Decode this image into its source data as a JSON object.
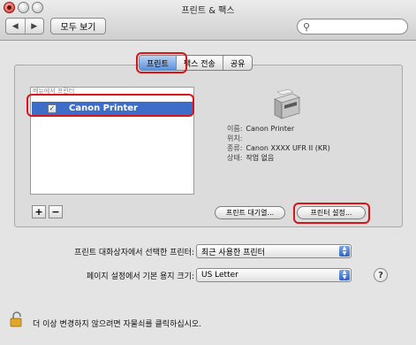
{
  "window": {
    "title": "프린트 & 팩스"
  },
  "toolbar": {
    "back": "◀",
    "forward": "▶",
    "show_all": "모두 보기",
    "search_placeholder": ""
  },
  "tabs": [
    {
      "label": "프린트",
      "active": true
    },
    {
      "label": "팩스 전송",
      "active": false
    },
    {
      "label": "공유",
      "active": false
    }
  ],
  "printer_list": {
    "header": "메뉴에서  프린터",
    "items": [
      {
        "name": "Canon Printer",
        "checked": true,
        "selected": true
      }
    ]
  },
  "printer_info": {
    "rows": [
      {
        "key": "이름:",
        "value": "Canon Printer"
      },
      {
        "key": "위치:",
        "value": ""
      },
      {
        "key": "종류:",
        "value": "Canon XXXX UFR II (KR)"
      },
      {
        "key": "상태:",
        "value": "작업 없음"
      }
    ]
  },
  "buttons": {
    "add": "+",
    "remove": "−",
    "print_queue": "프린트 대기열...",
    "printer_setup": "프린터 설정..."
  },
  "defaults": {
    "selected_printer_label": "프린트 대화상자에서 선택한 프린터:",
    "selected_printer_value": "최근 사용한 프린터",
    "paper_size_label": "페이지 설정에서 기본 용지 크기:",
    "paper_size_value": "US Letter"
  },
  "help": "?",
  "lock_message": "더 이상 변경하지 않으려면 자물쇠를 클릭하십시오.",
  "colors": {
    "selection": "#3c6ec9",
    "annotation": "#d8141a"
  }
}
